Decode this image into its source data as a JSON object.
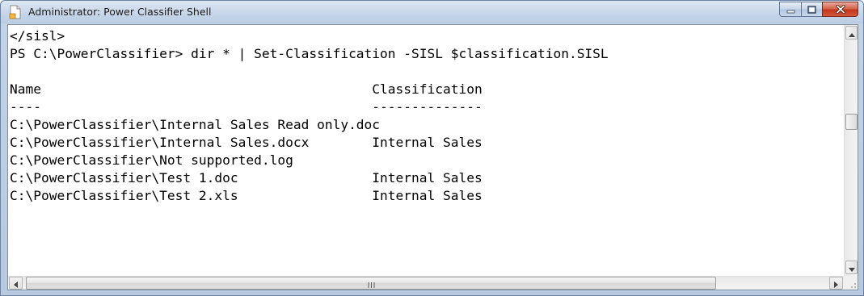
{
  "window": {
    "title": "Administrator: Power Classifier Shell"
  },
  "console": {
    "lines": [
      "</sisl>",
      "PS C:\\PowerClassifier> dir * | Set-Classification -SISL $classification.SISL",
      "",
      "Name                                          Classification",
      "----                                          --------------",
      "C:\\PowerClassifier\\Internal Sales Read only.doc",
      "C:\\PowerClassifier\\Internal Sales.docx        Internal Sales",
      "C:\\PowerClassifier\\Not supported.log",
      "C:\\PowerClassifier\\Test 1.doc                 Internal Sales",
      "C:\\PowerClassifier\\Test 2.xls                 Internal Sales",
      "",
      ""
    ]
  },
  "colors": {
    "close_button": "#c2361d",
    "titlebar": "#c7d6e9"
  },
  "icons": {
    "app": "console-app-icon",
    "minimize": "minimize-icon",
    "maximize": "maximize-icon",
    "close": "close-icon"
  }
}
